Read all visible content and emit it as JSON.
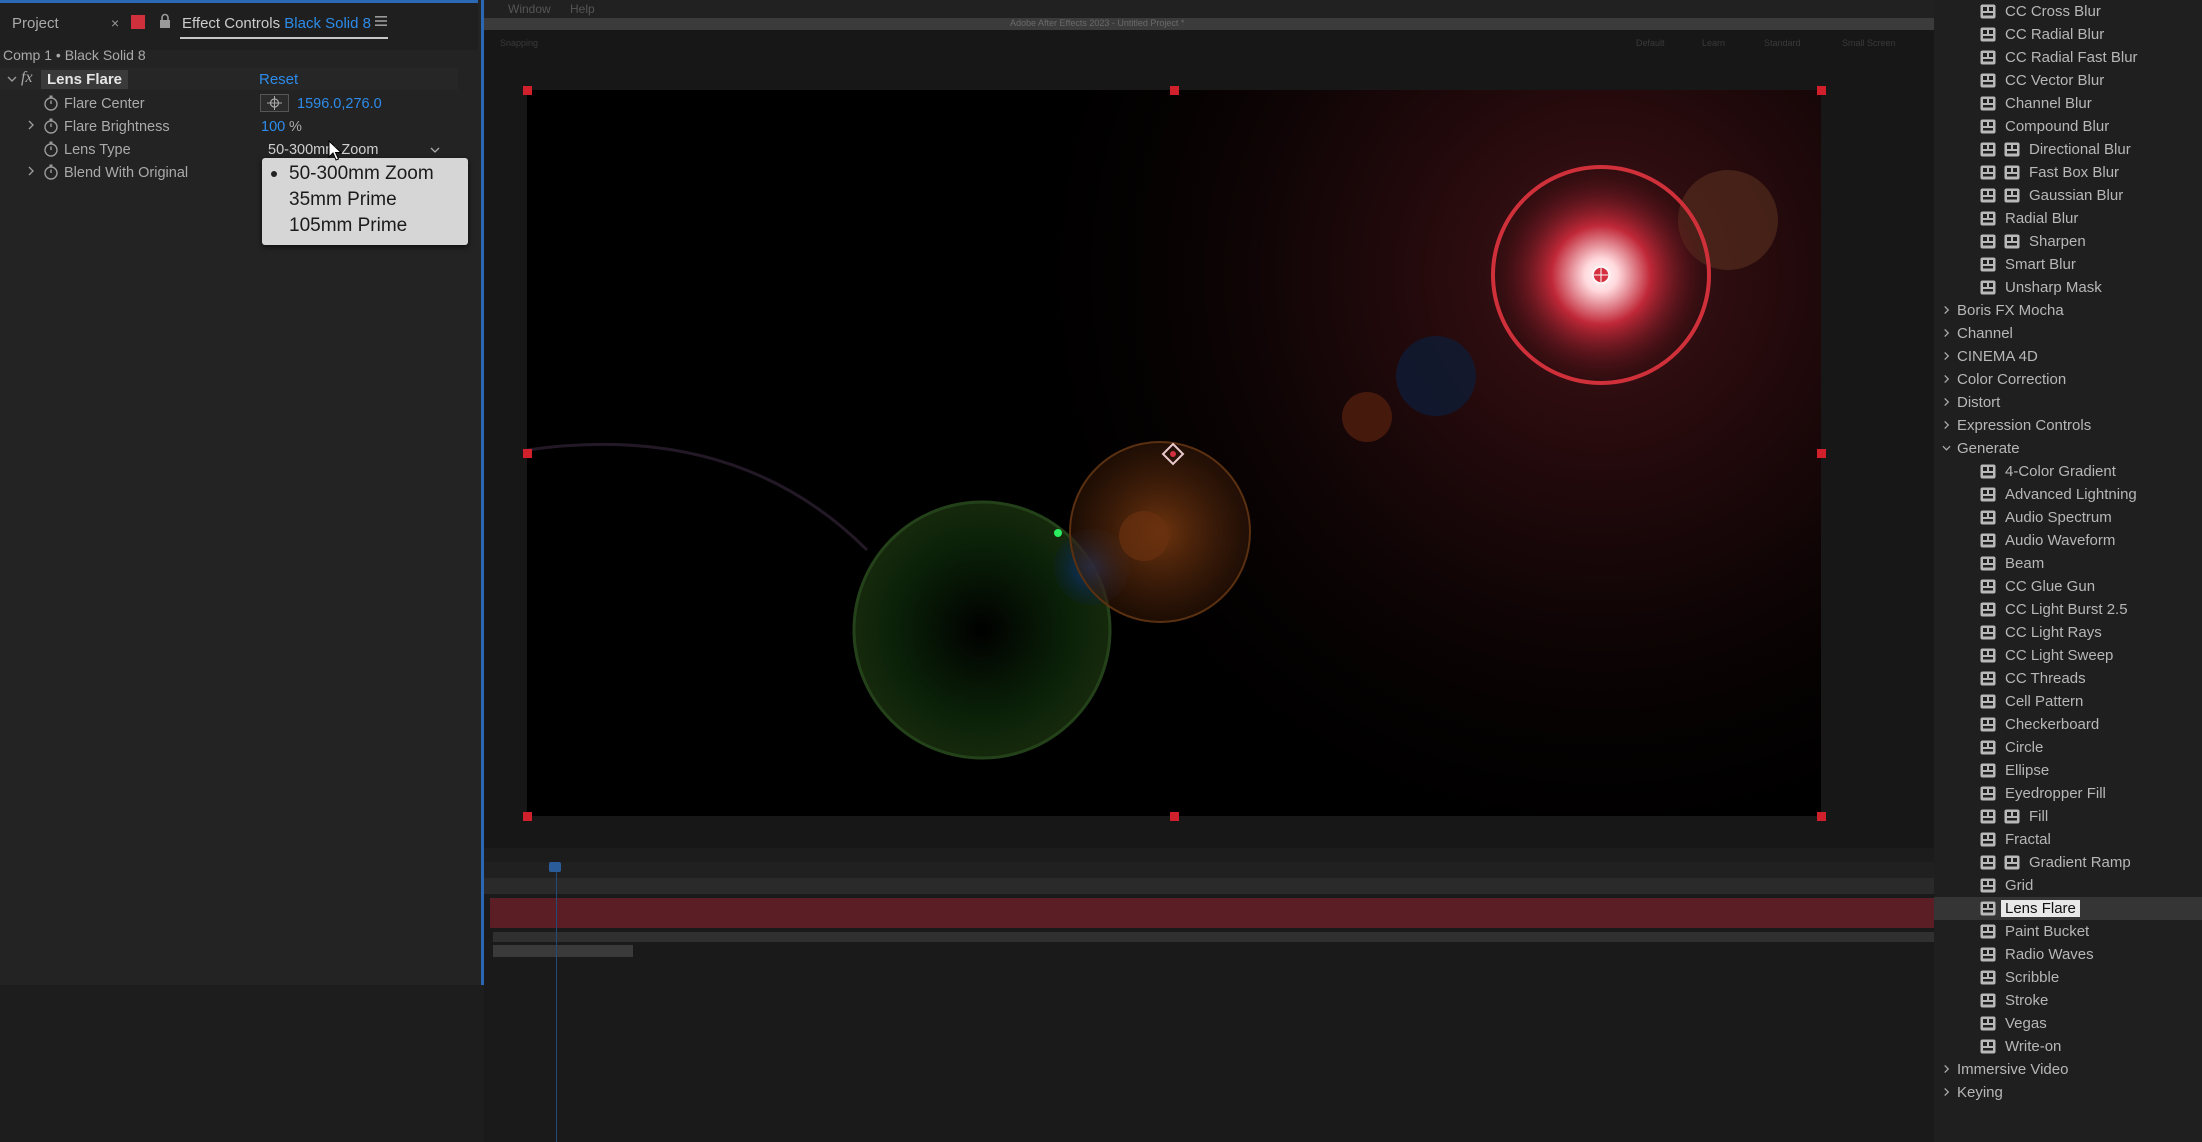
{
  "tabs": {
    "project": "Project",
    "project_close": "×",
    "effect_controls_prefix": "Effect Controls",
    "effect_controls_layer": "Black Solid 8"
  },
  "comp_title": "Comp 1 • Black Solid 8",
  "effect": {
    "name": "Lens Flare",
    "fx_symbol": "fx",
    "reset": "Reset",
    "properties": {
      "flare_center": {
        "label": "Flare Center",
        "value": "1596.0,276.0"
      },
      "flare_brightness": {
        "label": "Flare Brightness",
        "value": "100",
        "unit": "%"
      },
      "lens_type": {
        "label": "Lens Type",
        "value": "50-300mm Zoom"
      },
      "blend": {
        "label": "Blend With Original"
      }
    },
    "lens_options": [
      "50-300mm Zoom",
      "35mm Prime",
      "105mm Prime"
    ]
  },
  "menu": {
    "window": "Window",
    "help": "Help"
  },
  "app_title": "Adobe After Effects 2023 - Untitled Project *",
  "toolbar_faint": [
    "Snapping",
    "Default",
    "Learn",
    "Standard",
    "Small Screen"
  ],
  "effects_panel": {
    "blur_items": [
      {
        "label": "CC Cross Blur",
        "gpu": false
      },
      {
        "label": "CC Radial Blur",
        "gpu": false
      },
      {
        "label": "CC Radial Fast Blur",
        "gpu": false
      },
      {
        "label": "CC Vector Blur",
        "gpu": false
      },
      {
        "label": "Channel Blur",
        "gpu": false
      },
      {
        "label": "Compound Blur",
        "gpu": false
      },
      {
        "label": "Directional Blur",
        "gpu": true
      },
      {
        "label": "Fast Box Blur",
        "gpu": true
      },
      {
        "label": "Gaussian Blur",
        "gpu": true
      },
      {
        "label": "Radial Blur",
        "gpu": false
      },
      {
        "label": "Sharpen",
        "gpu": true
      },
      {
        "label": "Smart Blur",
        "gpu": false
      },
      {
        "label": "Unsharp Mask",
        "gpu": false
      }
    ],
    "categories_before": [
      "Boris FX Mocha",
      "Channel",
      "CINEMA 4D",
      "Color Correction",
      "Distort",
      "Expression Controls"
    ],
    "generate_label": "Generate",
    "generate_items": [
      {
        "label": "4-Color Gradient",
        "gpu": false
      },
      {
        "label": "Advanced Lightning",
        "gpu": false
      },
      {
        "label": "Audio Spectrum",
        "gpu": false
      },
      {
        "label": "Audio Waveform",
        "gpu": false
      },
      {
        "label": "Beam",
        "gpu": false
      },
      {
        "label": "CC Glue Gun",
        "gpu": false
      },
      {
        "label": "CC Light Burst 2.5",
        "gpu": false
      },
      {
        "label": "CC Light Rays",
        "gpu": false
      },
      {
        "label": "CC Light Sweep",
        "gpu": false
      },
      {
        "label": "CC Threads",
        "gpu": false
      },
      {
        "label": "Cell Pattern",
        "gpu": false
      },
      {
        "label": "Checkerboard",
        "gpu": false
      },
      {
        "label": "Circle",
        "gpu": false
      },
      {
        "label": "Ellipse",
        "gpu": false
      },
      {
        "label": "Eyedropper Fill",
        "gpu": false
      },
      {
        "label": "Fill",
        "gpu": true
      },
      {
        "label": "Fractal",
        "gpu": false
      },
      {
        "label": "Gradient Ramp",
        "gpu": true
      },
      {
        "label": "Grid",
        "gpu": false
      },
      {
        "label": "Lens Flare",
        "gpu": false,
        "selected": true
      },
      {
        "label": "Paint Bucket",
        "gpu": false
      },
      {
        "label": "Radio Waves",
        "gpu": false
      },
      {
        "label": "Scribble",
        "gpu": false
      },
      {
        "label": "Stroke",
        "gpu": false
      },
      {
        "label": "Vegas",
        "gpu": false
      },
      {
        "label": "Write-on",
        "gpu": false
      }
    ],
    "categories_after": [
      "Immersive Video",
      "Keying"
    ]
  },
  "colors": {
    "accent_blue": "#2d8ceb",
    "handle_red": "#d0202c",
    "label_red": "#d0303c"
  }
}
